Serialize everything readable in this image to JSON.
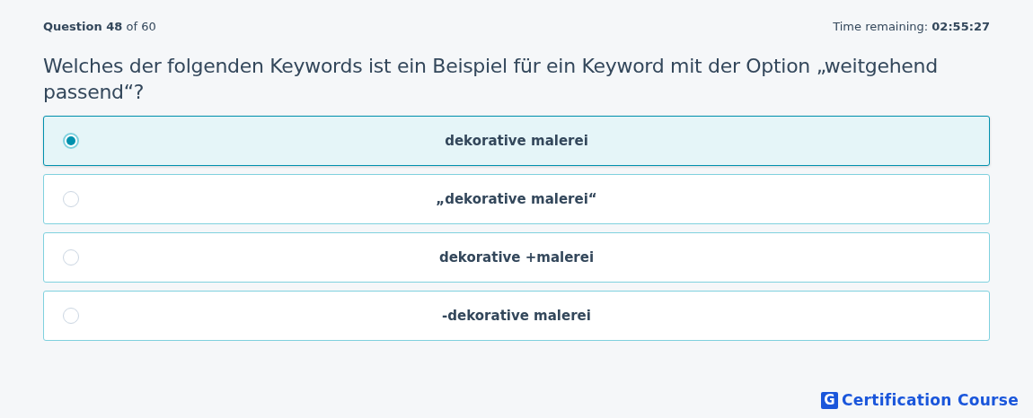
{
  "header": {
    "progress": "**Question 48** of 60",
    "timer": "Time remaining: **02:55:27**"
  },
  "question": "Welches der folgenden Keywords ist ein Beispiel für ein Keyword mit der Option „weitgehend passend“?",
  "options": [
    {
      "label": "dekorative malerei",
      "selected": true
    },
    {
      "label": "„dekorative malerei“",
      "selected": false
    },
    {
      "label": "dekorative +malerei",
      "selected": false
    },
    {
      "label": "-dekorative malerei",
      "selected": false
    }
  ],
  "brand": {
    "logo_letter": "G",
    "name": "Certification Course"
  }
}
